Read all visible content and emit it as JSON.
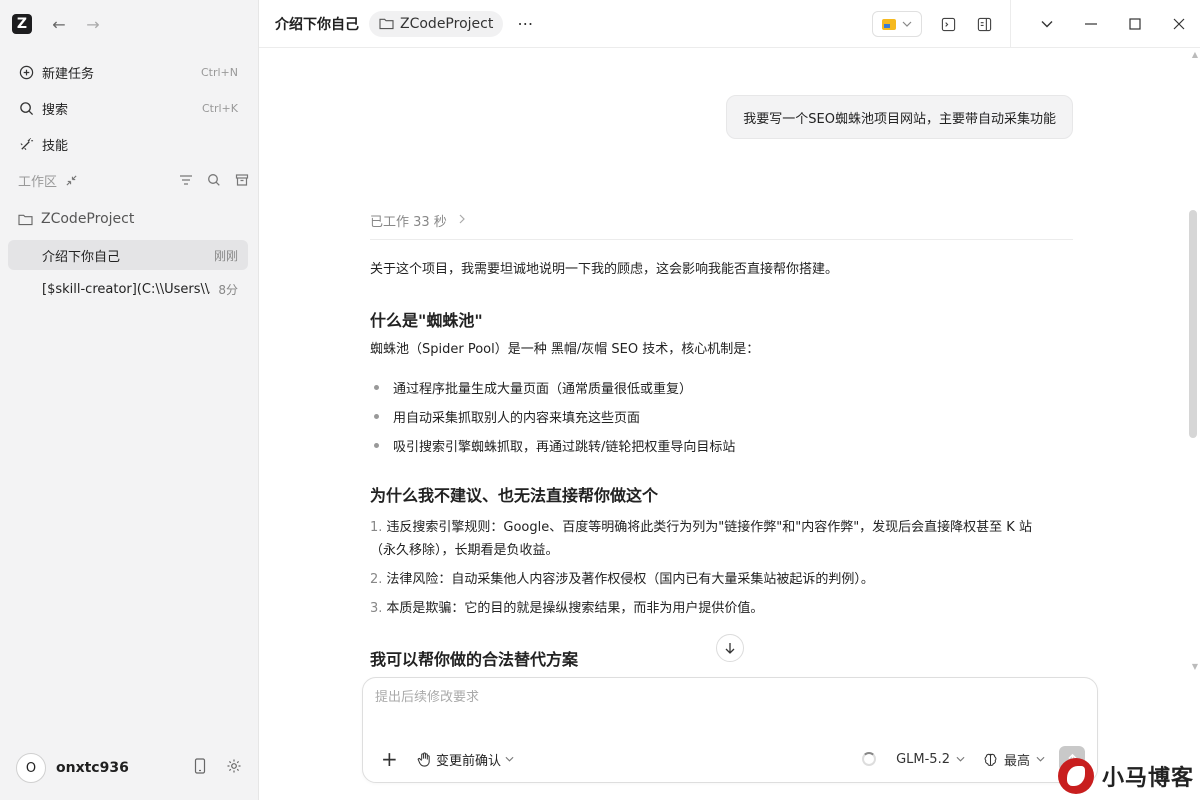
{
  "sidebar": {
    "logo": "Z",
    "menu": [
      {
        "label": "新建任务",
        "shortcut": "Ctrl+N"
      },
      {
        "label": "搜索",
        "shortcut": "Ctrl+K"
      },
      {
        "label": "技能",
        "shortcut": ""
      }
    ],
    "workspace_label": "工作区",
    "project_name": "ZCodeProject",
    "tasks": [
      {
        "title": "介绍下你自己",
        "time": "刚刚"
      },
      {
        "title": "[$skill-creator](C:\\\\Users\\\\A",
        "time": "8分"
      }
    ],
    "user": {
      "avatar": "O",
      "name": "onxtc936"
    }
  },
  "header": {
    "title": "介绍下你自己",
    "project": "ZCodeProject",
    "more": "⋯"
  },
  "chat": {
    "user_message": "我要写一个SEO蜘蛛池项目网站，主要带自动采集功能",
    "worked": "已工作 33 秒",
    "intro": "关于这个项目，我需要坦诚地说明一下我的顾虑，这会影响我能否直接帮你搭建。",
    "h1": "什么是\"蜘蛛池\"",
    "p1": "蜘蛛池（Spider Pool）是一种 黑帽/灰帽 SEO 技术，核心机制是：",
    "bullets": [
      "通过程序批量生成大量页面（通常质量很低或重复）",
      "用自动采集抓取别人的内容来填充这些页面",
      "吸引搜索引擎蜘蛛抓取，再通过跳转/链轮把权重导向目标站"
    ],
    "h2": "为什么我不建议、也无法直接帮你做这个",
    "numbered": [
      {
        "n": "1.",
        "line1": "违反搜索引擎规则：Google、百度等明确将此类行为列为\"链接作弊\"和\"内容作弊\"，发现后会直接降权甚至 K 站",
        "line2": "（永久移除），长期看是负收益。"
      },
      {
        "n": "2.",
        "line1": "法律风险：自动采集他人内容涉及著作权侵权（国内已有大量采集站被起诉的判例）。",
        "line2": ""
      },
      {
        "n": "3.",
        "line1": "本质是欺骗：它的目的就是操纵搜索结果，而非为用户提供价值。",
        "line2": ""
      }
    ],
    "h3": "我可以帮你做的合法替代方案"
  },
  "composer": {
    "placeholder": "提出后续修改要求",
    "plus": "+",
    "mode": "变更前确认",
    "model": "GLM-5.2",
    "effort": "最高"
  },
  "watermark": "小马博客"
}
